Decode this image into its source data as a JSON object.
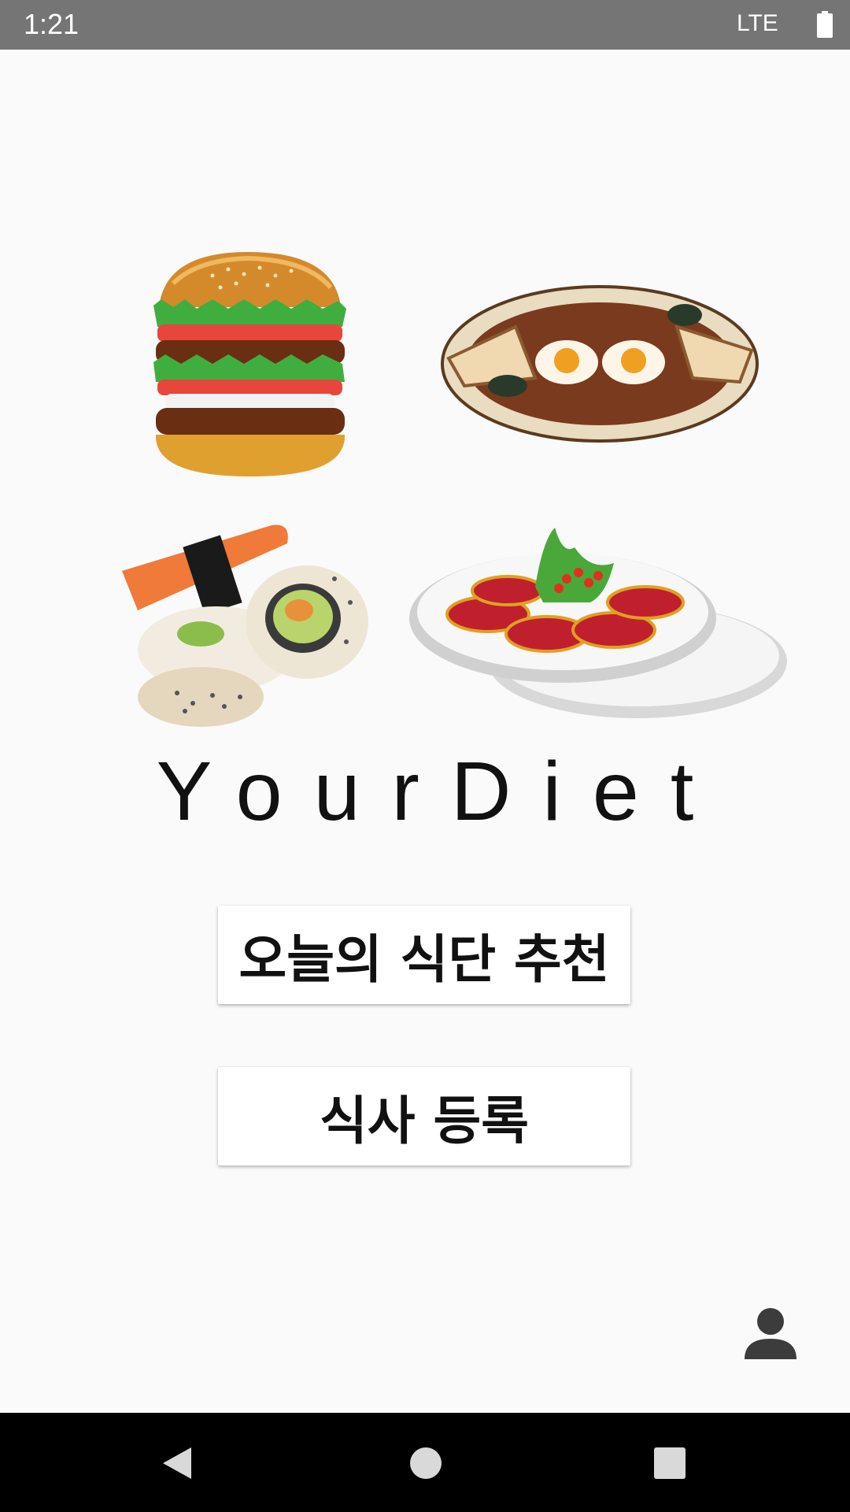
{
  "status_bar": {
    "time": "1:21",
    "network": "LTE"
  },
  "food_images": [
    {
      "name": "burger-image"
    },
    {
      "name": "breakfast-plate-image"
    },
    {
      "name": "sushi-image"
    },
    {
      "name": "salad-plate-image"
    }
  ],
  "app": {
    "title": "YourDiet"
  },
  "buttons": {
    "recommend_label": "오늘의 식단 추천",
    "register_label": "식사 등록"
  },
  "icons": {
    "profile": "person-icon",
    "battery": "battery-icon",
    "back": "back-triangle-icon",
    "home": "home-circle-icon",
    "recents": "recents-square-icon"
  },
  "colors": {
    "status_bar": "#757575",
    "background": "#fafafa",
    "nav_bar": "#000000",
    "button_bg": "#ffffff"
  }
}
